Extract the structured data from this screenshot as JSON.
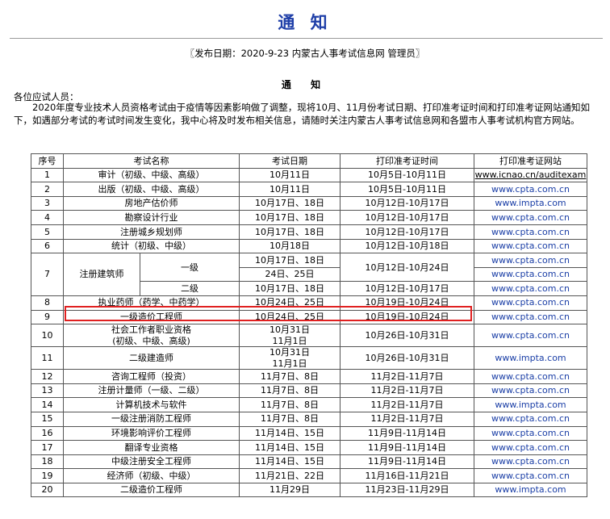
{
  "page": {
    "title": "通 知",
    "publish_info": "〖发布日期：2020-9-23 内蒙古人事考试信息网 管理员〗",
    "subtitle": "通 知",
    "greeting": "各位应试人员：",
    "body": "2020年度专业技术人员资格考试由于疫情等因素影响做了调整，现将10月、11月份考试日期、打印准考证时间和打印准考证网站通知如下，如遇部分考试的考试时间发生变化，我中心将及时发布相关信息，请随时关注内蒙古人事考试信息网和各盟市人事考试机构官方网站。"
  },
  "table": {
    "headers": [
      "序号",
      "考试名称",
      "考试日期",
      "打印准考证时间",
      "打印准考证网站"
    ],
    "rows": [
      {
        "no": "1",
        "name": "审计（初级、中级、高级）",
        "date": "10月11日",
        "print": "10月5日-10月11日",
        "site": "www.icnao.cn/auditexam"
      },
      {
        "no": "2",
        "name": "出版（初级、中级、高级）",
        "date": "10月11日",
        "print": "10月5日-10月11日",
        "site": "www.cpta.com.cn"
      },
      {
        "no": "3",
        "name": "房地产估价师",
        "date": "10月17日、18日",
        "print": "10月12日-10月17日",
        "site": "www.impta.com"
      },
      {
        "no": "4",
        "name": "勘察设计行业",
        "date": "10月17日、18日",
        "print": "10月12日-10月17日",
        "site": "www.cpta.com.cn"
      },
      {
        "no": "5",
        "name": "注册城乡规划师",
        "date": "10月17日、18日",
        "print": "10月12日-10月17日",
        "site": "www.cpta.com.cn"
      },
      {
        "no": "6",
        "name": "统计（初级、中级）",
        "date": "10月18日",
        "print": "10月12日-10月18日",
        "site": "www.cpta.com.cn"
      },
      {
        "no": "7",
        "name": "注册建筑师",
        "sub1": "一级",
        "date1a": "10月17日、18日",
        "date1b": "24日、25日",
        "print1": "10月12日-10月24日",
        "site1a": "www.cpta.com.cn",
        "site1b": "www.cpta.com.cn",
        "sub2": "二级",
        "date2": "10月17日、18日",
        "print2": "10月12日-10月17日",
        "site2": "www.cpta.com.cn"
      },
      {
        "no": "8",
        "name": "执业药师（药学、中药学）",
        "date": "10月24日、25日",
        "print": "10月19日-10月24日",
        "site": "www.cpta.com.cn"
      },
      {
        "no": "9",
        "name": "一级造价工程师",
        "date": "10月24日、25日",
        "print": "10月19日-10月24日",
        "site": "www.cpta.com.cn"
      },
      {
        "no": "10",
        "name1": "社会工作者职业资格",
        "name2": "(初级、中级、高级)",
        "date1": "10月31日",
        "date2": "11月1日",
        "print": "10月26日-10月31日",
        "site": "www.cpta.com.cn"
      },
      {
        "no": "11",
        "name": "二级建造师",
        "date1": "10月31日",
        "date2": "11月1日",
        "print": "10月26日-10月31日",
        "site": "www.impta.com"
      },
      {
        "no": "12",
        "name": "咨询工程师（投资）",
        "date": "11月7日、8日",
        "print": "11月2日-11月7日",
        "site": "www.cpta.com.cn"
      },
      {
        "no": "13",
        "name": "注册计量师（一级、二级）",
        "date": "11月7日、8日",
        "print": "11月2日-11月7日",
        "site": "www.cpta.com.cn"
      },
      {
        "no": "14",
        "name": "计算机技术与软件",
        "date": "11月7日、8日",
        "print": "11月2日-11月7日",
        "site": "www.impta.com"
      },
      {
        "no": "15",
        "name": "一级注册消防工程师",
        "date": "11月7日、8日",
        "print": "11月2日-11月7日",
        "site": "www.cpta.com.cn"
      },
      {
        "no": "16",
        "name": "环境影响评价工程师",
        "date": "11月14日、15日",
        "print": "11月9日-11月14日",
        "site": "www.cpta.com.cn"
      },
      {
        "no": "17",
        "name": "翻译专业资格",
        "date": "11月14日、15日",
        "print": "11月9日-11月14日",
        "site": "www.cpta.com.cn"
      },
      {
        "no": "18",
        "name": "中级注册安全工程师",
        "date": "11月14日、15日",
        "print": "11月9日-11月14日",
        "site": "www.cpta.com.cn"
      },
      {
        "no": "19",
        "name": "经济师（初级、中级）",
        "date": "11月21日、22日",
        "print": "11月16日-11月21日",
        "site": "www.cpta.com.cn"
      },
      {
        "no": "20",
        "name": "二级造价工程师",
        "date": "11月29日",
        "print": "11月23日-11月29日",
        "site": "www.impta.com"
      }
    ]
  },
  "colors": {
    "title_blue": "#1f3fa8",
    "link_blue": "#1a3ea6",
    "highlight_red": "#e02020"
  }
}
